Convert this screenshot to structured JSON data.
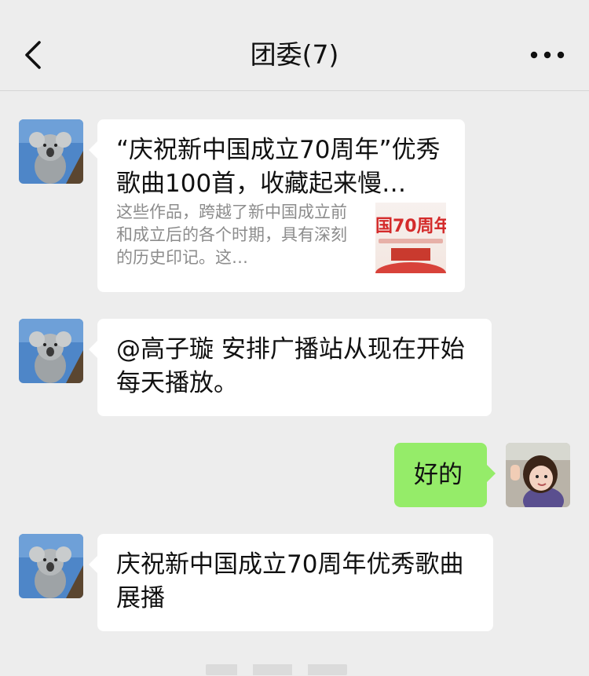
{
  "header": {
    "title": "团委(7)",
    "back_icon": "chevron-left-icon",
    "more_icon": "more-dots-icon"
  },
  "messages": [
    {
      "sender": "other",
      "avatar_icon": "koala-avatar",
      "type": "link-card",
      "card_title": "“庆祝新中国成立70周年”优秀歌曲100首，收藏起来慢…",
      "card_desc": "这些作品，跨越了新中国成立前和成立后的各个时期，具有深刻的历史印记。这…",
      "thumb_text": "国70周年"
    },
    {
      "sender": "other",
      "avatar_icon": "koala-avatar",
      "type": "text",
      "text": "@高子璇 安排广播站从现在开始每天播放。"
    },
    {
      "sender": "me",
      "avatar_icon": "girl-avatar",
      "type": "text",
      "text": "好的"
    },
    {
      "sender": "other",
      "avatar_icon": "koala-avatar",
      "type": "text",
      "text": "庆祝新中国成立70周年优秀歌曲展播"
    }
  ],
  "colors": {
    "background": "#ededed",
    "bubble_other": "#ffffff",
    "bubble_me": "#95ec69"
  }
}
